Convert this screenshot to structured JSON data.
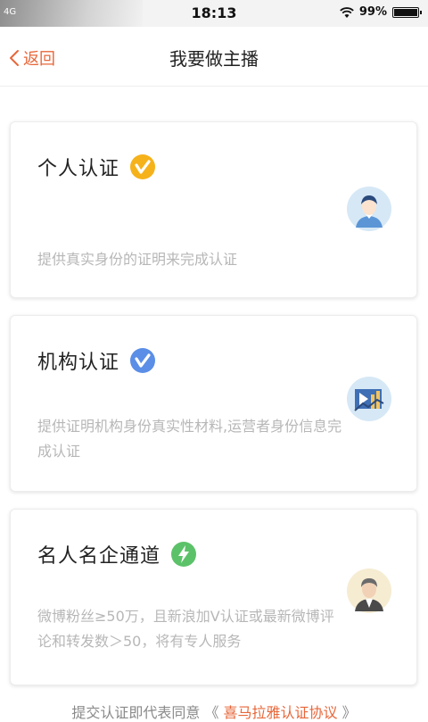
{
  "status_bar": {
    "network": "4G",
    "time": "18:13",
    "battery": "99%",
    "battery_level": 0.99
  },
  "nav": {
    "back_label": "返回",
    "title": "我要做主播"
  },
  "cards": [
    {
      "title": "个人认证",
      "badge_icon": "v-badge-icon",
      "badge_color": "#f6b21b",
      "description": "提供真实身份的证明来完成认证",
      "avatar_icon": "person-avatar-icon",
      "avatar_color": "#cfe3f4"
    },
    {
      "title": "机构认证",
      "badge_icon": "v-badge-icon",
      "badge_color": "#5b8ee6",
      "description": "提供证明机构身份真实性材料,运营者身份信息完成认证",
      "avatar_icon": "organization-avatar-icon",
      "avatar_color": "#cfe3f4"
    },
    {
      "title": "名人名企通道",
      "badge_icon": "lightning-badge-icon",
      "badge_color": "#5cc269",
      "description": "微博粉丝≥50万，且新浪加V认证或最新微博评论和转发数＞50，将有专人服务",
      "avatar_icon": "celebrity-avatar-icon",
      "avatar_color": "#f6ecd2"
    }
  ],
  "footer": {
    "prefix": "提交认证即代表同意",
    "open_quote": "《",
    "link_label": "喜马拉雅认证协议",
    "close_quote": "》"
  },
  "colors": {
    "accent": "#e7673a",
    "muted_text": "#b7b7b7"
  }
}
